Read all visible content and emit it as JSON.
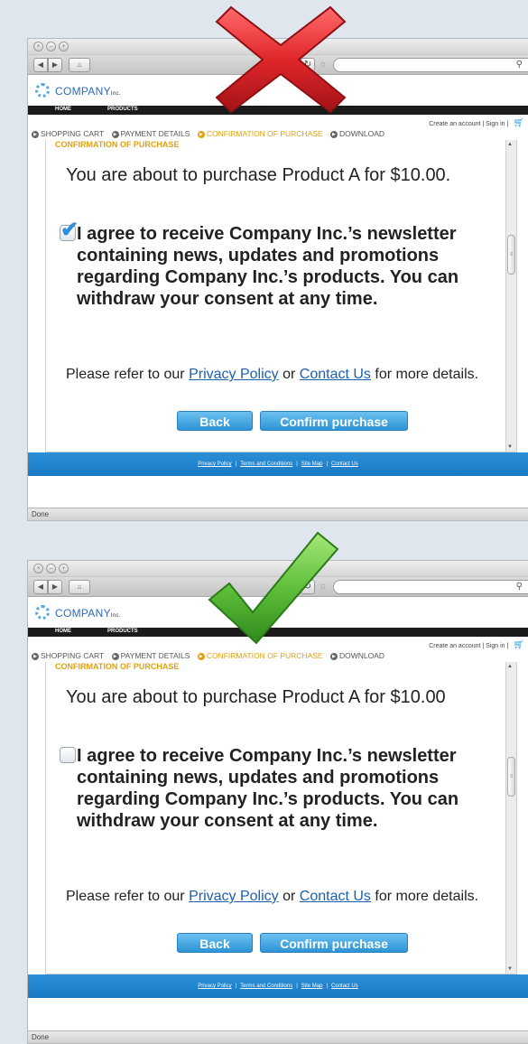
{
  "colors": {
    "brand_blue": "#2b6bb5",
    "step_active": "#e0a210",
    "footer_blue": "#1879c4",
    "bad_mark": "#e0262b",
    "good_mark": "#5fbf3a"
  },
  "icons": {
    "bad": "red-x-mark-icon",
    "good": "green-check-mark-icon"
  },
  "panels": [
    {
      "logo": {
        "name": "COMPANY",
        "suffix": "Inc."
      },
      "menu": [
        "HOME",
        "PRODUCTS"
      ],
      "account": {
        "create": "Create an account",
        "signin": "Sign in"
      },
      "steps": [
        "SHOPPING CART",
        "PAYMENT DETAILS",
        "CONFIRMATION OF PURCHASE",
        "DOWNLOAD"
      ],
      "active_step": 2,
      "section_title": "CONFIRMATION OF PURCHASE",
      "purchase_text": "You are about to purchase Product A for $10.00.",
      "checked": true,
      "consent_text": "I agree to receive Company Inc.’s newsletter containing news, updates and promotions regarding Company Inc.’s products. You can withdraw your consent at any time.",
      "refer": {
        "prefix": "Please refer to our ",
        "privacy_link": "Privacy Policy",
        "or": " or ",
        "contact_link": "Contact Us",
        "suffix": " for more details."
      },
      "buttons": {
        "back": "Back",
        "confirm": "Confirm purchase"
      },
      "footer_links": [
        "Privacy Policy",
        "Terms and Conditions",
        "Site Map",
        "Contact Us"
      ],
      "status": "Done"
    },
    {
      "logo": {
        "name": "COMPANY",
        "suffix": "Inc."
      },
      "menu": [
        "HOME",
        "PRODUCTS"
      ],
      "account": {
        "create": "Create an account",
        "signin": "Sign in"
      },
      "steps": [
        "SHOPPING CART",
        "PAYMENT DETAILS",
        "CONFIRMATION OF PURCHASE",
        "DOWNLOAD"
      ],
      "active_step": 2,
      "section_title": "CONFIRMATION OF PURCHASE",
      "purchase_text": "You are about to purchase Product A for $10.00",
      "checked": false,
      "consent_text": "I agree to receive Company Inc.’s newsletter containing news, updates and promotions regarding Company Inc.’s products. You can withdraw your consent at any time.",
      "refer": {
        "prefix": "Please refer to our ",
        "privacy_link": "Privacy Policy",
        "or": " or ",
        "contact_link": "Contact Us",
        "suffix": " for more details."
      },
      "buttons": {
        "back": "Back",
        "confirm": "Confirm purchase"
      },
      "footer_links": [
        "Privacy Policy",
        "Terms and Conditions",
        "Site Map",
        "Contact Us"
      ],
      "status": "Done"
    }
  ]
}
